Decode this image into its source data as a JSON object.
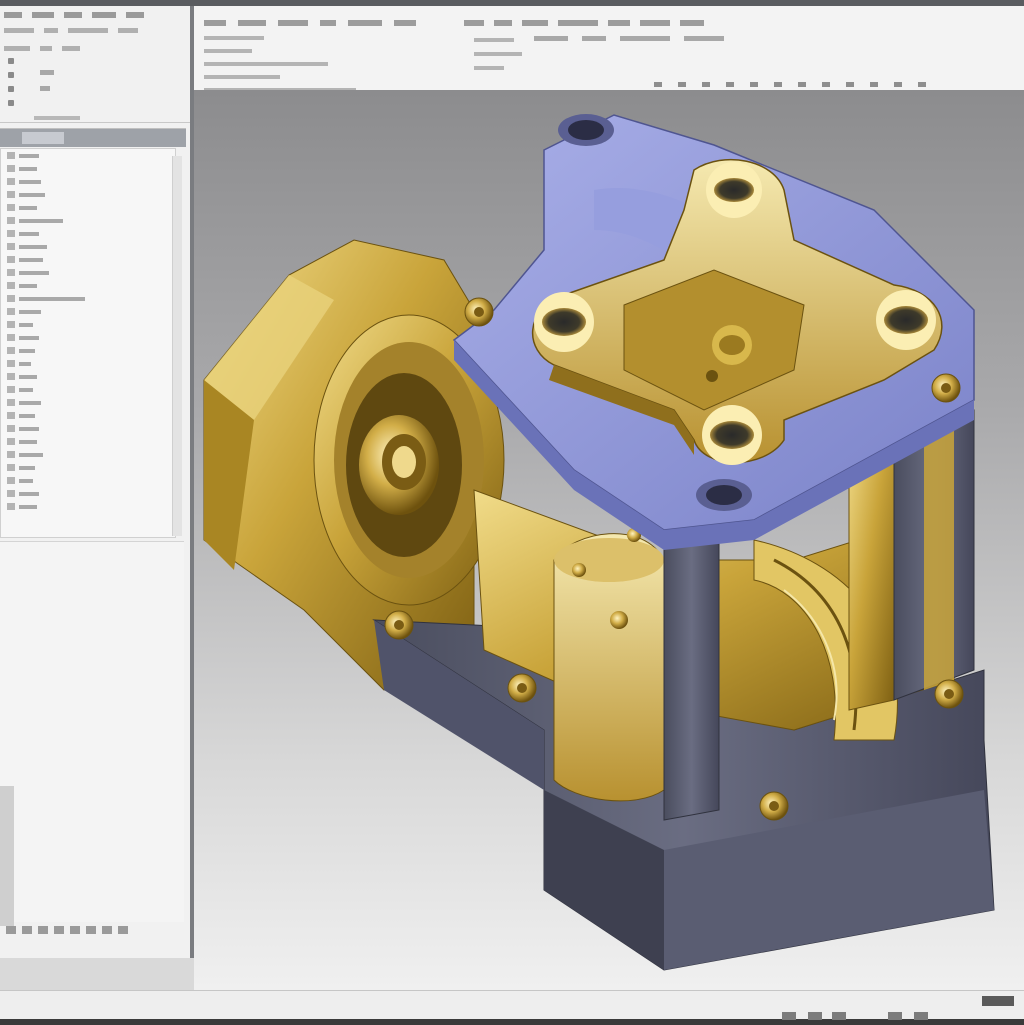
{
  "colors": {
    "accent_part_blue": "#8e96d9",
    "part_dark": "#55586a",
    "part_brass": "#c9a43a",
    "viewport_top": "#8c8c8e",
    "viewport_bottom": "#f0f0f0"
  },
  "sidebar": {
    "feature_tree": {
      "items": [
        {
          "icon": "feature-icon"
        },
        {
          "icon": "feature-icon"
        },
        {
          "icon": "feature-icon"
        },
        {
          "icon": "feature-icon"
        },
        {
          "icon": "feature-icon"
        },
        {
          "icon": "feature-icon"
        },
        {
          "icon": "feature-icon"
        },
        {
          "icon": "feature-icon"
        },
        {
          "icon": "feature-icon"
        },
        {
          "icon": "feature-icon"
        },
        {
          "icon": "feature-icon"
        },
        {
          "icon": "feature-icon"
        },
        {
          "icon": "feature-icon"
        },
        {
          "icon": "feature-icon"
        },
        {
          "icon": "feature-icon"
        },
        {
          "icon": "feature-icon"
        },
        {
          "icon": "feature-icon"
        },
        {
          "icon": "feature-icon"
        },
        {
          "icon": "feature-icon"
        },
        {
          "icon": "feature-icon"
        },
        {
          "icon": "feature-icon"
        },
        {
          "icon": "feature-icon"
        },
        {
          "icon": "feature-icon"
        },
        {
          "icon": "feature-icon"
        },
        {
          "icon": "feature-icon"
        },
        {
          "icon": "feature-icon"
        },
        {
          "icon": "feature-icon"
        },
        {
          "icon": "feature-icon"
        }
      ]
    }
  },
  "viewport": {
    "model": "cad-assembly-housing"
  }
}
